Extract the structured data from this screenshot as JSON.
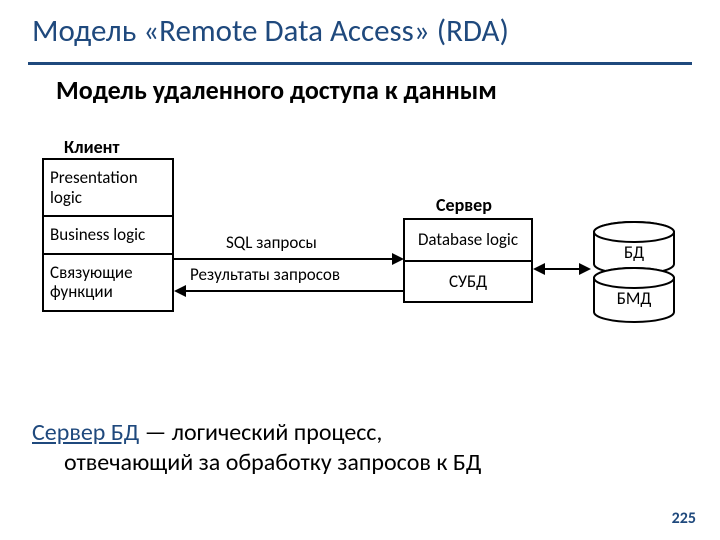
{
  "title": "Модель «Remote Data Access» (RDA)",
  "subtitle": "Модель удаленного доступа к данным",
  "labels": {
    "client": "Клиент",
    "server": "Сервер"
  },
  "client_layers": {
    "presentation": "Presentation logic",
    "business": "Business logic",
    "binding": "Связующие функции"
  },
  "server_layers": {
    "db_logic": "Database logic",
    "subd": "СУБД"
  },
  "arrows": {
    "sql": "SQL запросы",
    "results": "Результаты запросов"
  },
  "storage": {
    "db": "БД",
    "bmd": "БМД"
  },
  "definition": {
    "term": "Сервер БД",
    "rest1": " — логический процесс,",
    "rest2": "отвечающий за обработку запросов к БД"
  },
  "page": "225"
}
